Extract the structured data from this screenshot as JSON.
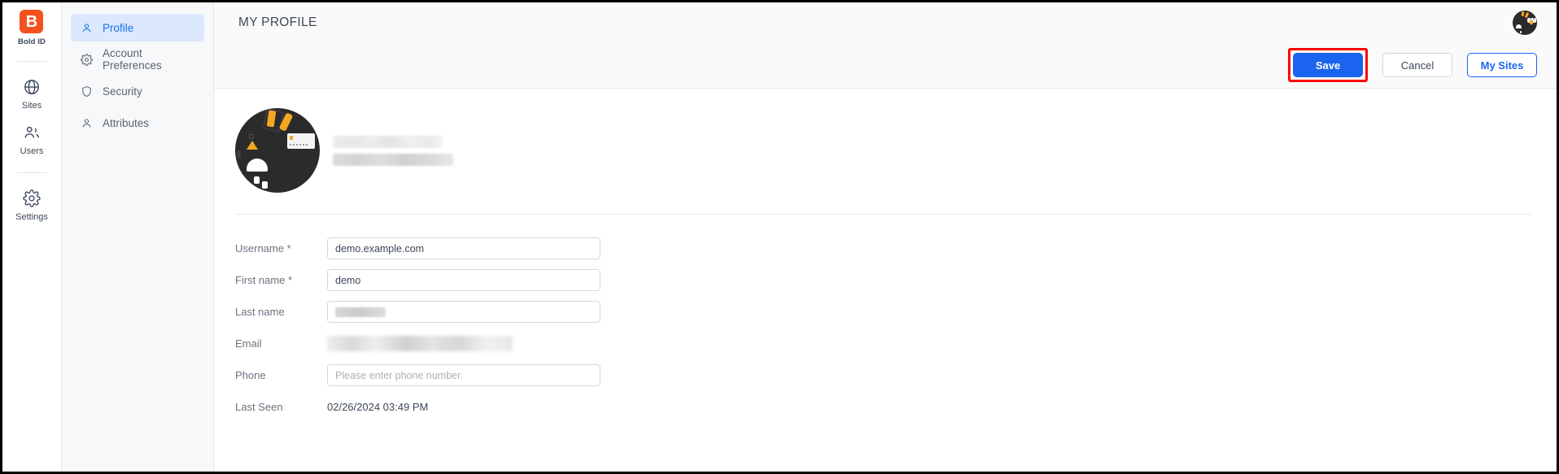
{
  "rail": {
    "brand": {
      "mark": "B",
      "label": "Bold ID",
      "color": "#f4511e"
    },
    "items": [
      {
        "label": "Sites",
        "icon": "globe-icon"
      },
      {
        "label": "Users",
        "icon": "users-icon"
      },
      {
        "label": "Settings",
        "icon": "gear-icon"
      }
    ]
  },
  "subnav": {
    "items": [
      {
        "label": "Profile",
        "icon": "person-icon",
        "active": true
      },
      {
        "label": "Account Preferences",
        "icon": "gear-icon",
        "active": false
      },
      {
        "label": "Security",
        "icon": "shield-icon",
        "active": false
      },
      {
        "label": "Attributes",
        "icon": "person-icon",
        "active": false
      }
    ]
  },
  "header": {
    "title": "MY PROFILE",
    "avatar_name": "user-avatar"
  },
  "actions": {
    "save_label": "Save",
    "cancel_label": "Cancel",
    "my_sites_label": "My Sites",
    "highlight_color": "#ff0000",
    "primary_color": "#1a64ef"
  },
  "profile": {
    "avatar_name": "profile-avatar",
    "display_name_redacted": true
  },
  "form": {
    "fields": [
      {
        "label": "Username *",
        "value": "demo.example.com",
        "placeholder": "",
        "type": "input",
        "redacted": false
      },
      {
        "label": "First name *",
        "value": "demo",
        "placeholder": "",
        "type": "input",
        "redacted": false
      },
      {
        "label": "Last name",
        "value": "",
        "placeholder": "",
        "type": "input",
        "redacted": true
      },
      {
        "label": "Email",
        "value": "",
        "placeholder": "",
        "type": "redacted-text",
        "redacted": true
      },
      {
        "label": "Phone",
        "value": "",
        "placeholder": "Please enter phone number",
        "type": "input",
        "redacted": false
      },
      {
        "label": "Last Seen",
        "value": "02/26/2024 03:49 PM",
        "placeholder": "",
        "type": "static",
        "redacted": false
      }
    ]
  }
}
